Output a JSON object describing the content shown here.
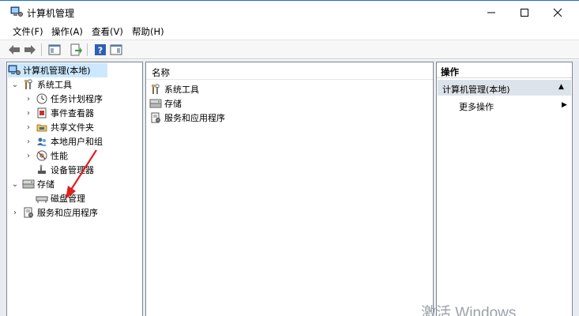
{
  "window": {
    "title": "计算机管理",
    "controls": {
      "minimize": "─",
      "maximize": "☐",
      "close": "✕"
    }
  },
  "menu": {
    "file": "文件(F)",
    "action": "操作(A)",
    "view": "查看(V)",
    "help": "帮助(H)"
  },
  "toolbar": {
    "back": "⇦",
    "forward": "⇨",
    "help": "?"
  },
  "tree": {
    "root": "计算机管理(本地)",
    "system_tools": "系统工具",
    "task_scheduler": "任务计划程序",
    "event_viewer": "事件查看器",
    "shared_folders": "共享文件夹",
    "local_users": "本地用户和组",
    "performance": "性能",
    "device_manager": "设备管理器",
    "storage": "存储",
    "disk_management": "磁盘管理",
    "services_apps": "服务和应用程序",
    "expand_glyph": "›",
    "collapse_glyph": "⌄"
  },
  "list": {
    "header": "名称",
    "items": [
      "系统工具",
      "存储",
      "服务和应用程序"
    ]
  },
  "actions": {
    "header": "操作",
    "section": "计算机管理(本地)",
    "section_arrow": "▲",
    "more": "更多操作",
    "more_arrow": "▶"
  },
  "watermark": "激活 Windows",
  "colors": {
    "selection": "#cce8ff",
    "annotation_arrow": "#e02020"
  }
}
